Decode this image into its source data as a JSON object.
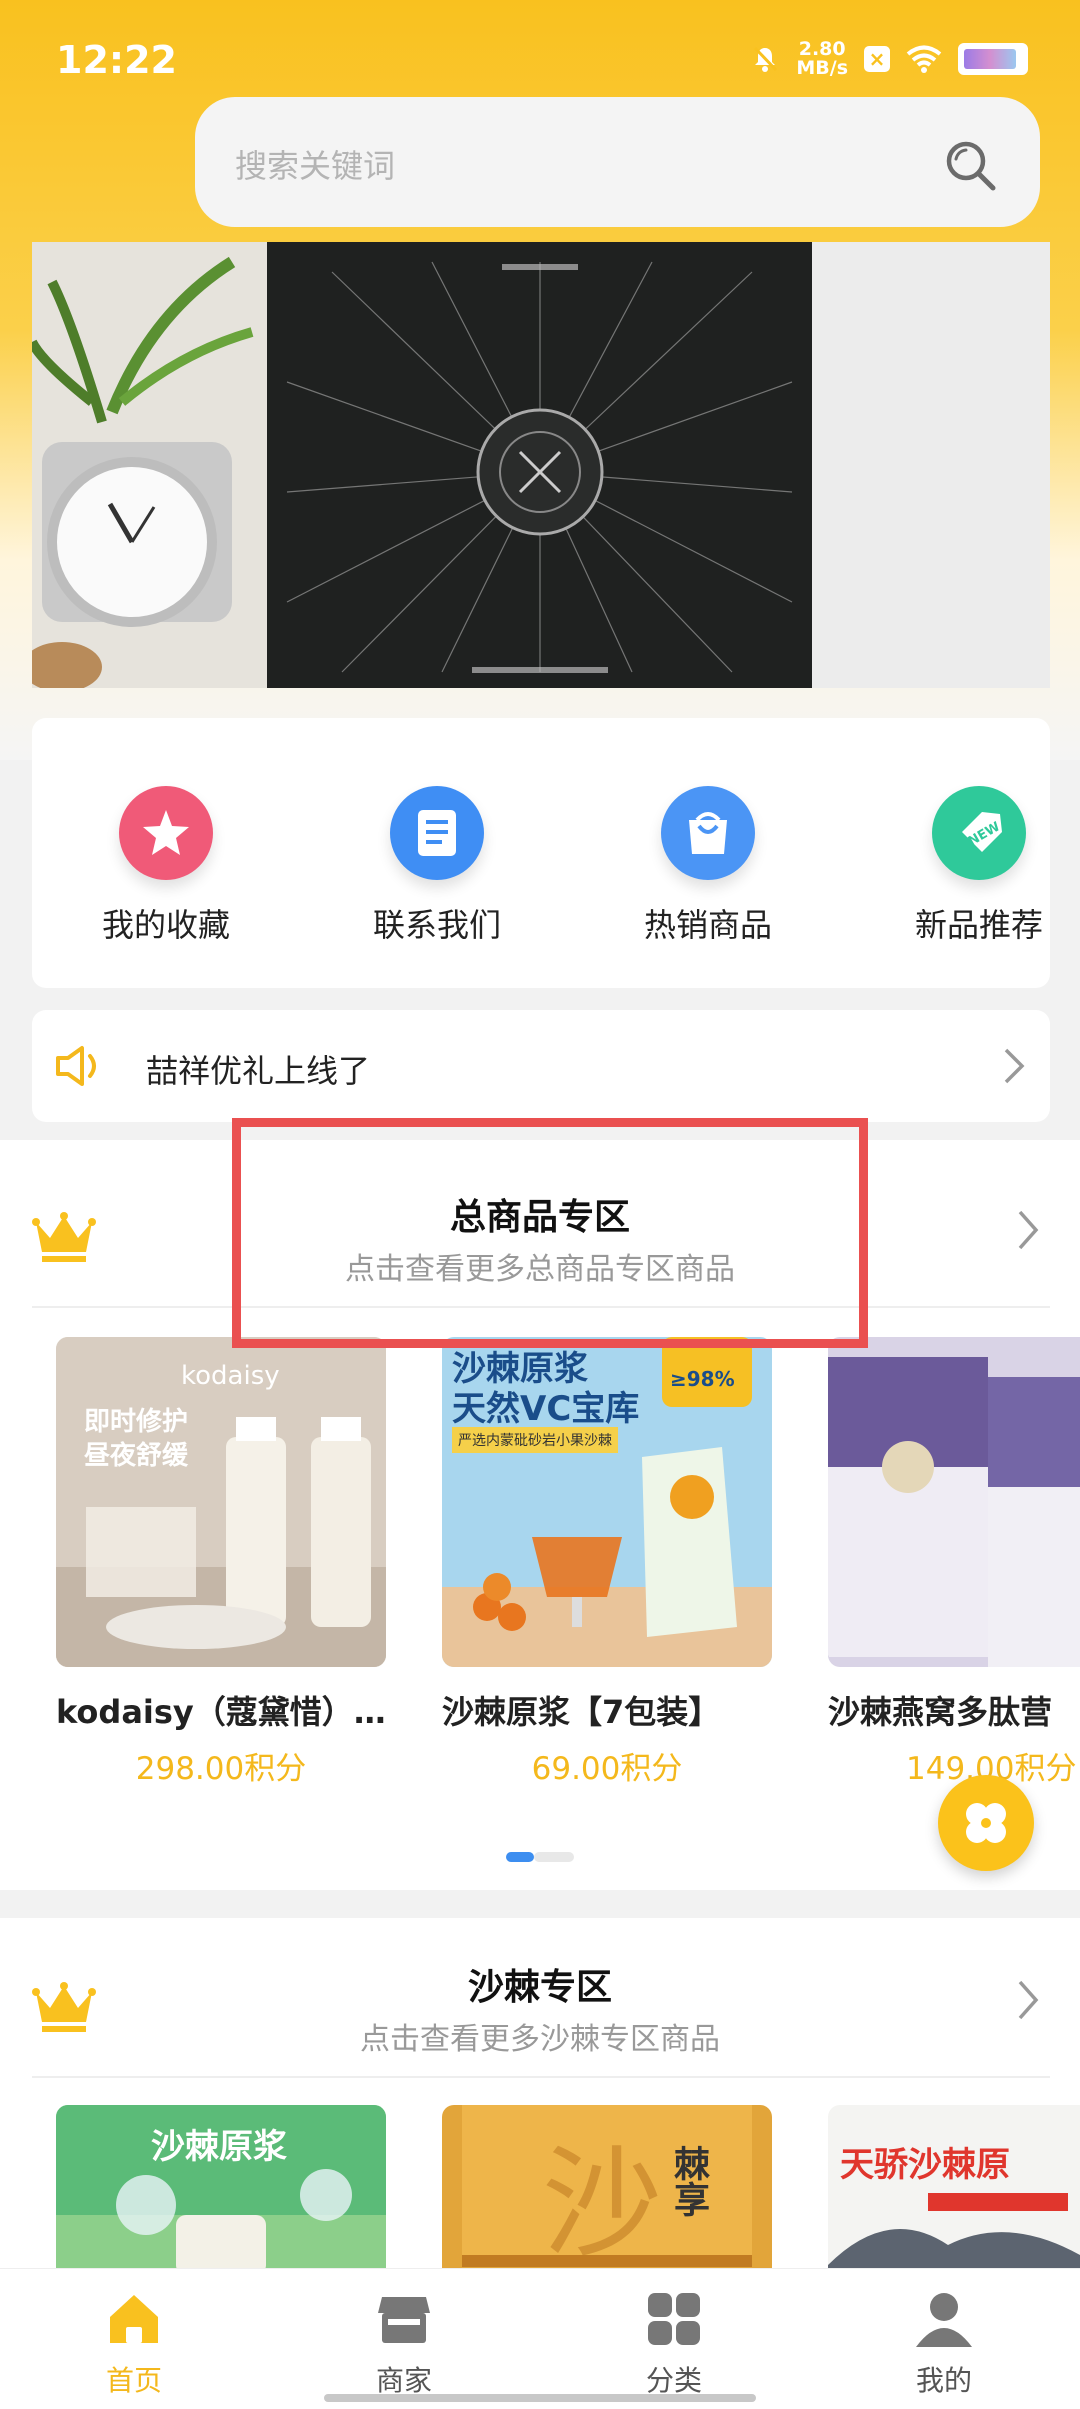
{
  "status_bar": {
    "time": "12:22",
    "speed_value": "2.80",
    "speed_unit": "MB/s"
  },
  "search": {
    "placeholder": "搜索关键词"
  },
  "quick_menu": [
    {
      "label": "我的收藏",
      "icon": "star-icon",
      "color": "#f05a78"
    },
    {
      "label": "联系我们",
      "icon": "document-icon",
      "color": "#3f8ef4"
    },
    {
      "label": "热销商品",
      "icon": "shopping-bag-icon",
      "color": "#4b95f5"
    },
    {
      "label": "新品推荐",
      "icon": "new-tag-icon",
      "color": "#2fc99a"
    }
  ],
  "notice": {
    "text": "喆祥优礼上线了"
  },
  "sections": [
    {
      "title": "总商品专区",
      "subtitle": "点击查看更多总商品专区商品",
      "products": [
        {
          "name": "kodaisy（蔻黛惜）…",
          "price": "298.00积分",
          "img_brand": "kodaisy",
          "img_line1": "即时修护",
          "img_line2": "昼夜舒缓"
        },
        {
          "name": "沙棘原浆【7包装】",
          "price": "69.00积分",
          "img_line1": "沙棘原浆",
          "img_line2": "天然VC宝库",
          "img_line3": "严选内蒙砒砂岩小果沙棘",
          "img_badge": "≥98%"
        },
        {
          "name": "沙棘燕窝多肽营",
          "price": "149.00积分"
        }
      ]
    },
    {
      "title": "沙棘专区",
      "subtitle": "点击查看更多沙棘专区商品",
      "products": [
        {
          "img_line1": "沙棘原浆"
        },
        {
          "img_line1": "棘享"
        },
        {
          "img_line1": "天骄沙棘原"
        }
      ]
    }
  ],
  "bottom_nav": [
    {
      "label": "首页",
      "active": true
    },
    {
      "label": "商家",
      "active": false
    },
    {
      "label": "分类",
      "active": false
    },
    {
      "label": "我的",
      "active": false
    }
  ],
  "colors": {
    "accent": "#f9c11f",
    "price": "#f4b81c",
    "highlight": "#ea5050",
    "pager_active": "#3d8ef0"
  }
}
